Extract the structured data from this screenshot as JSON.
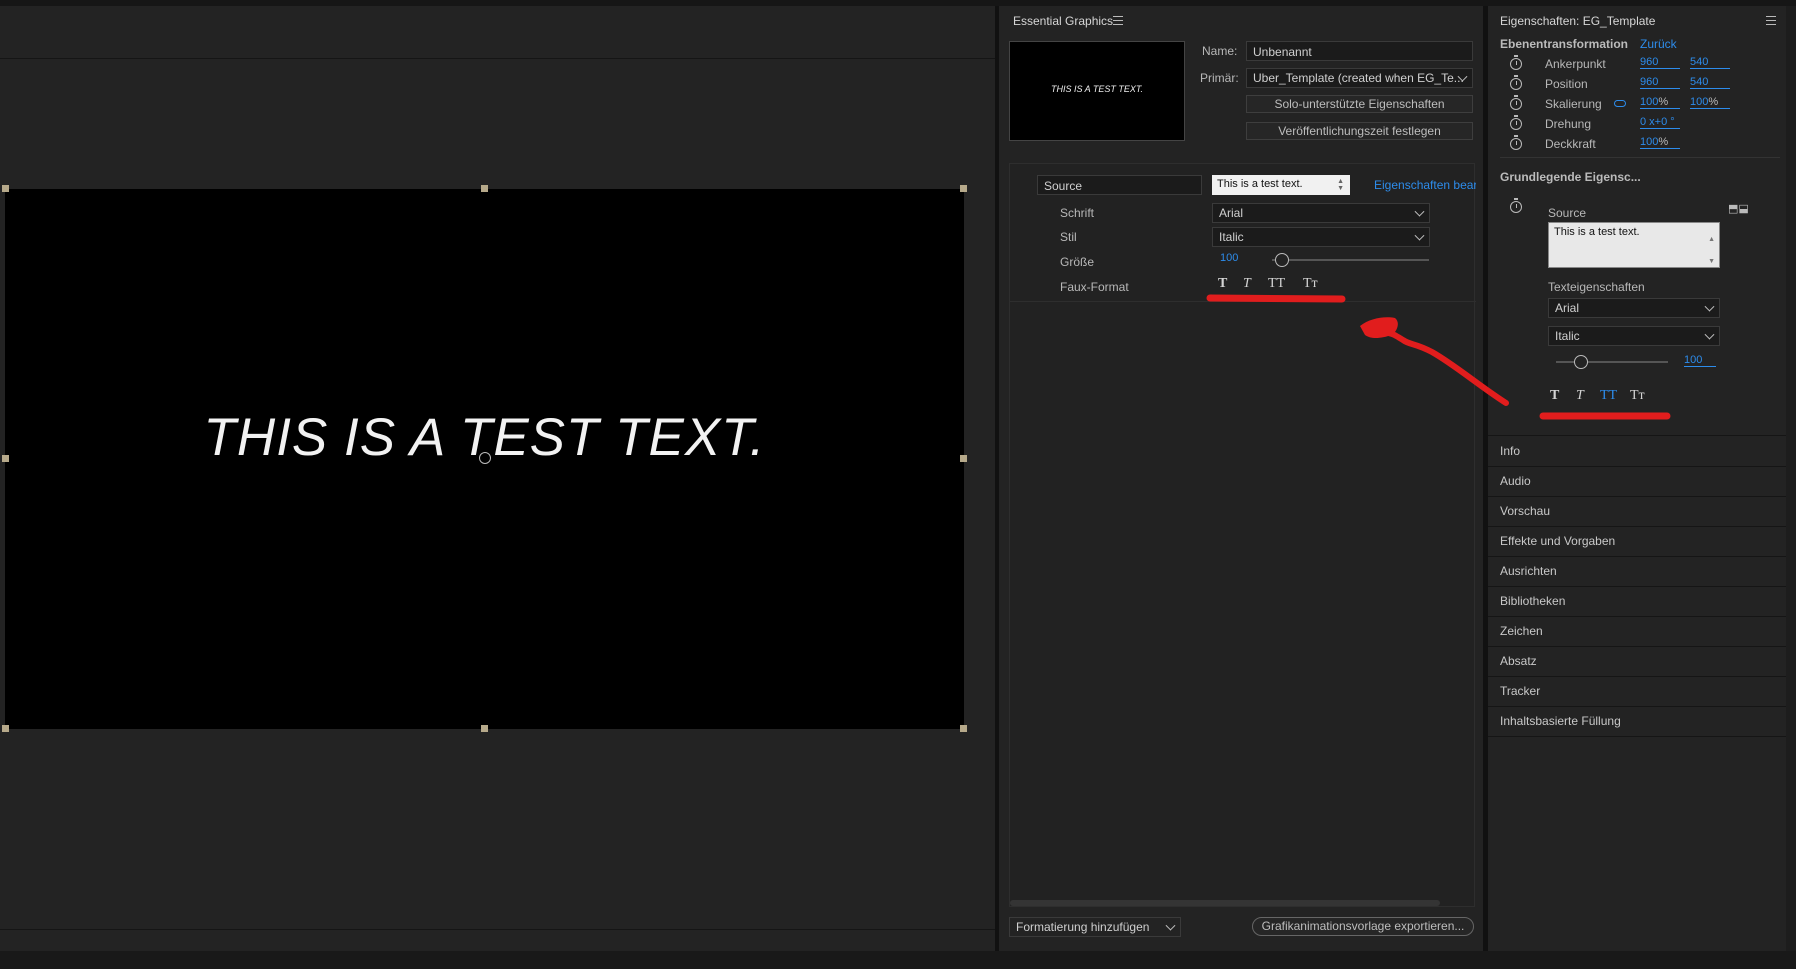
{
  "program_monitor": {
    "canvas_text": "THIS IS A TEST TEXT."
  },
  "essential_graphics": {
    "title": "Essential Graphics",
    "thumbnail_text": "THIS IS A TEST TEXT.",
    "name_label": "Name:",
    "name_value": "Unbenannt",
    "primary_label": "Primär:",
    "primary_value": "Uber_Template (created when EG_Te...",
    "solo_button": "Solo-unterstützte Eigenschaften",
    "publish_button": "Veröffentlichungszeit festlegen",
    "source_label": "Source",
    "source_value": "This is a test text.",
    "edit_props_link": "Eigenschaften bearb",
    "font_label": "Schrift",
    "font_value": "Arial",
    "style_label": "Stil",
    "style_value": "Italic",
    "size_label": "Größe",
    "size_value": "100",
    "faux_label": "Faux-Format",
    "faux_buttons": [
      "T",
      "T",
      "TT",
      "Tт"
    ],
    "add_format_dropdown": "Formatierung hinzufügen",
    "export_button": "Grafikanimationsvorlage exportieren..."
  },
  "properties": {
    "title": "Eigenschaften: EG_Template",
    "layer_transform": "Ebenentransformation",
    "reset_link": "Zurück",
    "rows": [
      {
        "label": "Ankerpunkt",
        "v1": "960",
        "v2": "540"
      },
      {
        "label": "Position",
        "v1": "960",
        "v2": "540"
      },
      {
        "label": "Skalierung",
        "v1": "100",
        "v1_unit": "%",
        "v2": "100",
        "v2_unit": "%"
      },
      {
        "label": "Drehung",
        "v1": "0 x+0 °"
      },
      {
        "label": "Deckkraft",
        "v1": "100",
        "v1_unit": "%"
      }
    ],
    "basic_props": "Grundlegende Eigensc...",
    "source_label": "Source",
    "source_text": "This is a test text.",
    "text_props_label": "Texteigenschaften",
    "font_value": "Arial",
    "style_value": "Italic",
    "size_value": "100",
    "faux_buttons": [
      "T",
      "T",
      "TT",
      "Tт"
    ]
  },
  "sections": [
    "Info",
    "Audio",
    "Vorschau",
    "Effekte und Vorgaben",
    "Ausrichten",
    "Bibliotheken",
    "Zeichen",
    "Absatz",
    "Tracker",
    "Inhaltsbasierte Füllung"
  ],
  "colors": {
    "accent": "#2d8ceb",
    "annotation": "#e11d1d",
    "panel_bg": "#232323",
    "canvas_bg": "#000000"
  }
}
